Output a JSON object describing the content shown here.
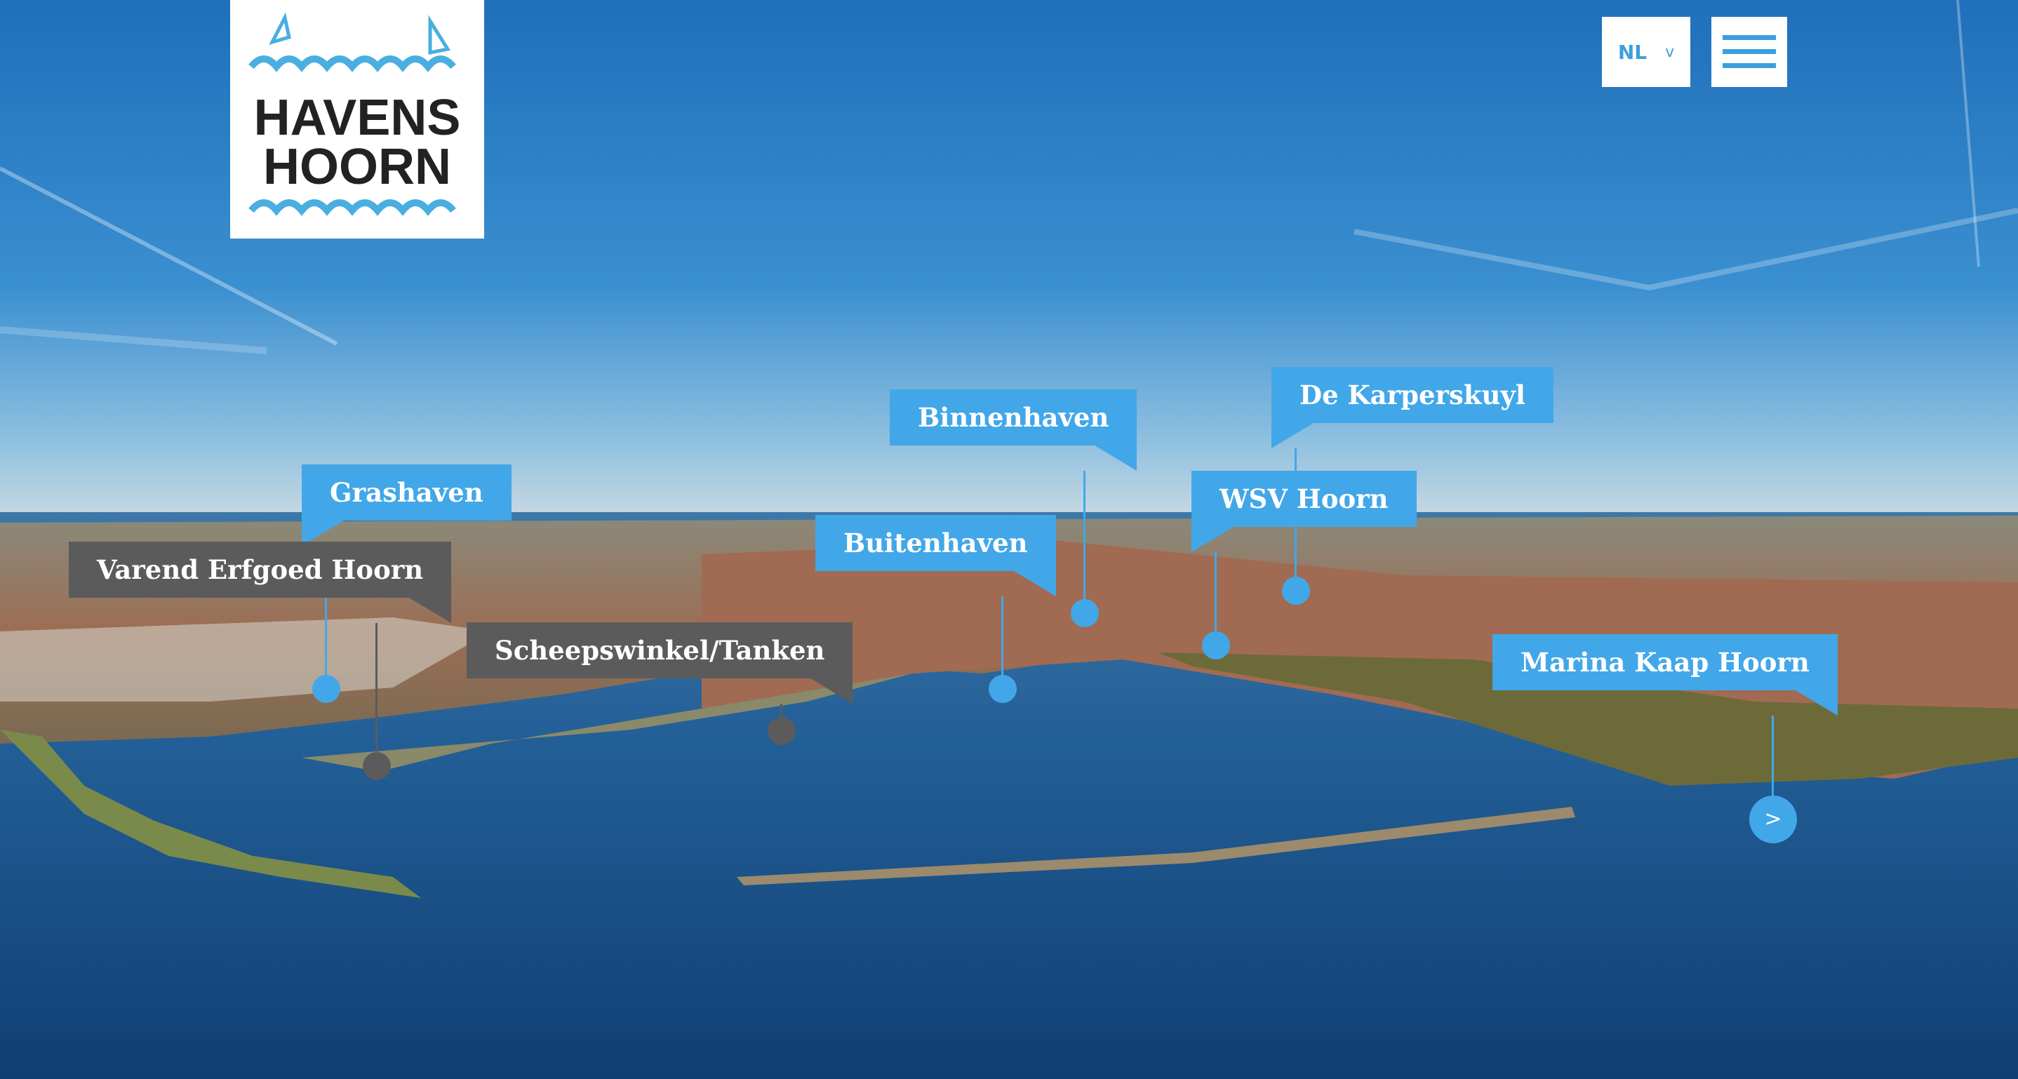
{
  "page_title": "Havens Hoorn",
  "logo": {
    "text_line1": "HAVENS",
    "text_line2": "HOORN"
  },
  "header": {
    "language": "NL",
    "language_chevron": "v",
    "menu_icon": "hamburger-menu-icon"
  },
  "harbors": [
    {
      "label": "Grashaven",
      "color": "blue"
    },
    {
      "label": "Varend Erfgoed Hoorn",
      "color": "grey"
    },
    {
      "label": "Scheepswinkel/Tanken",
      "color": "grey"
    },
    {
      "label": "Buitenhaven",
      "color": "blue"
    },
    {
      "label": "Binnenhaven",
      "color": "blue"
    },
    {
      "label": "WSV Hoorn",
      "color": "blue"
    },
    {
      "label": "De Karperskuyl",
      "color": "blue"
    },
    {
      "label": "Marina Kaap Hoorn",
      "color": "blue"
    }
  ],
  "next_button": ">",
  "colors": {
    "accent": "#42a7e8",
    "grey": "#5b5b5b",
    "sky": "#2d7fc6",
    "water": "#1f5f97"
  }
}
